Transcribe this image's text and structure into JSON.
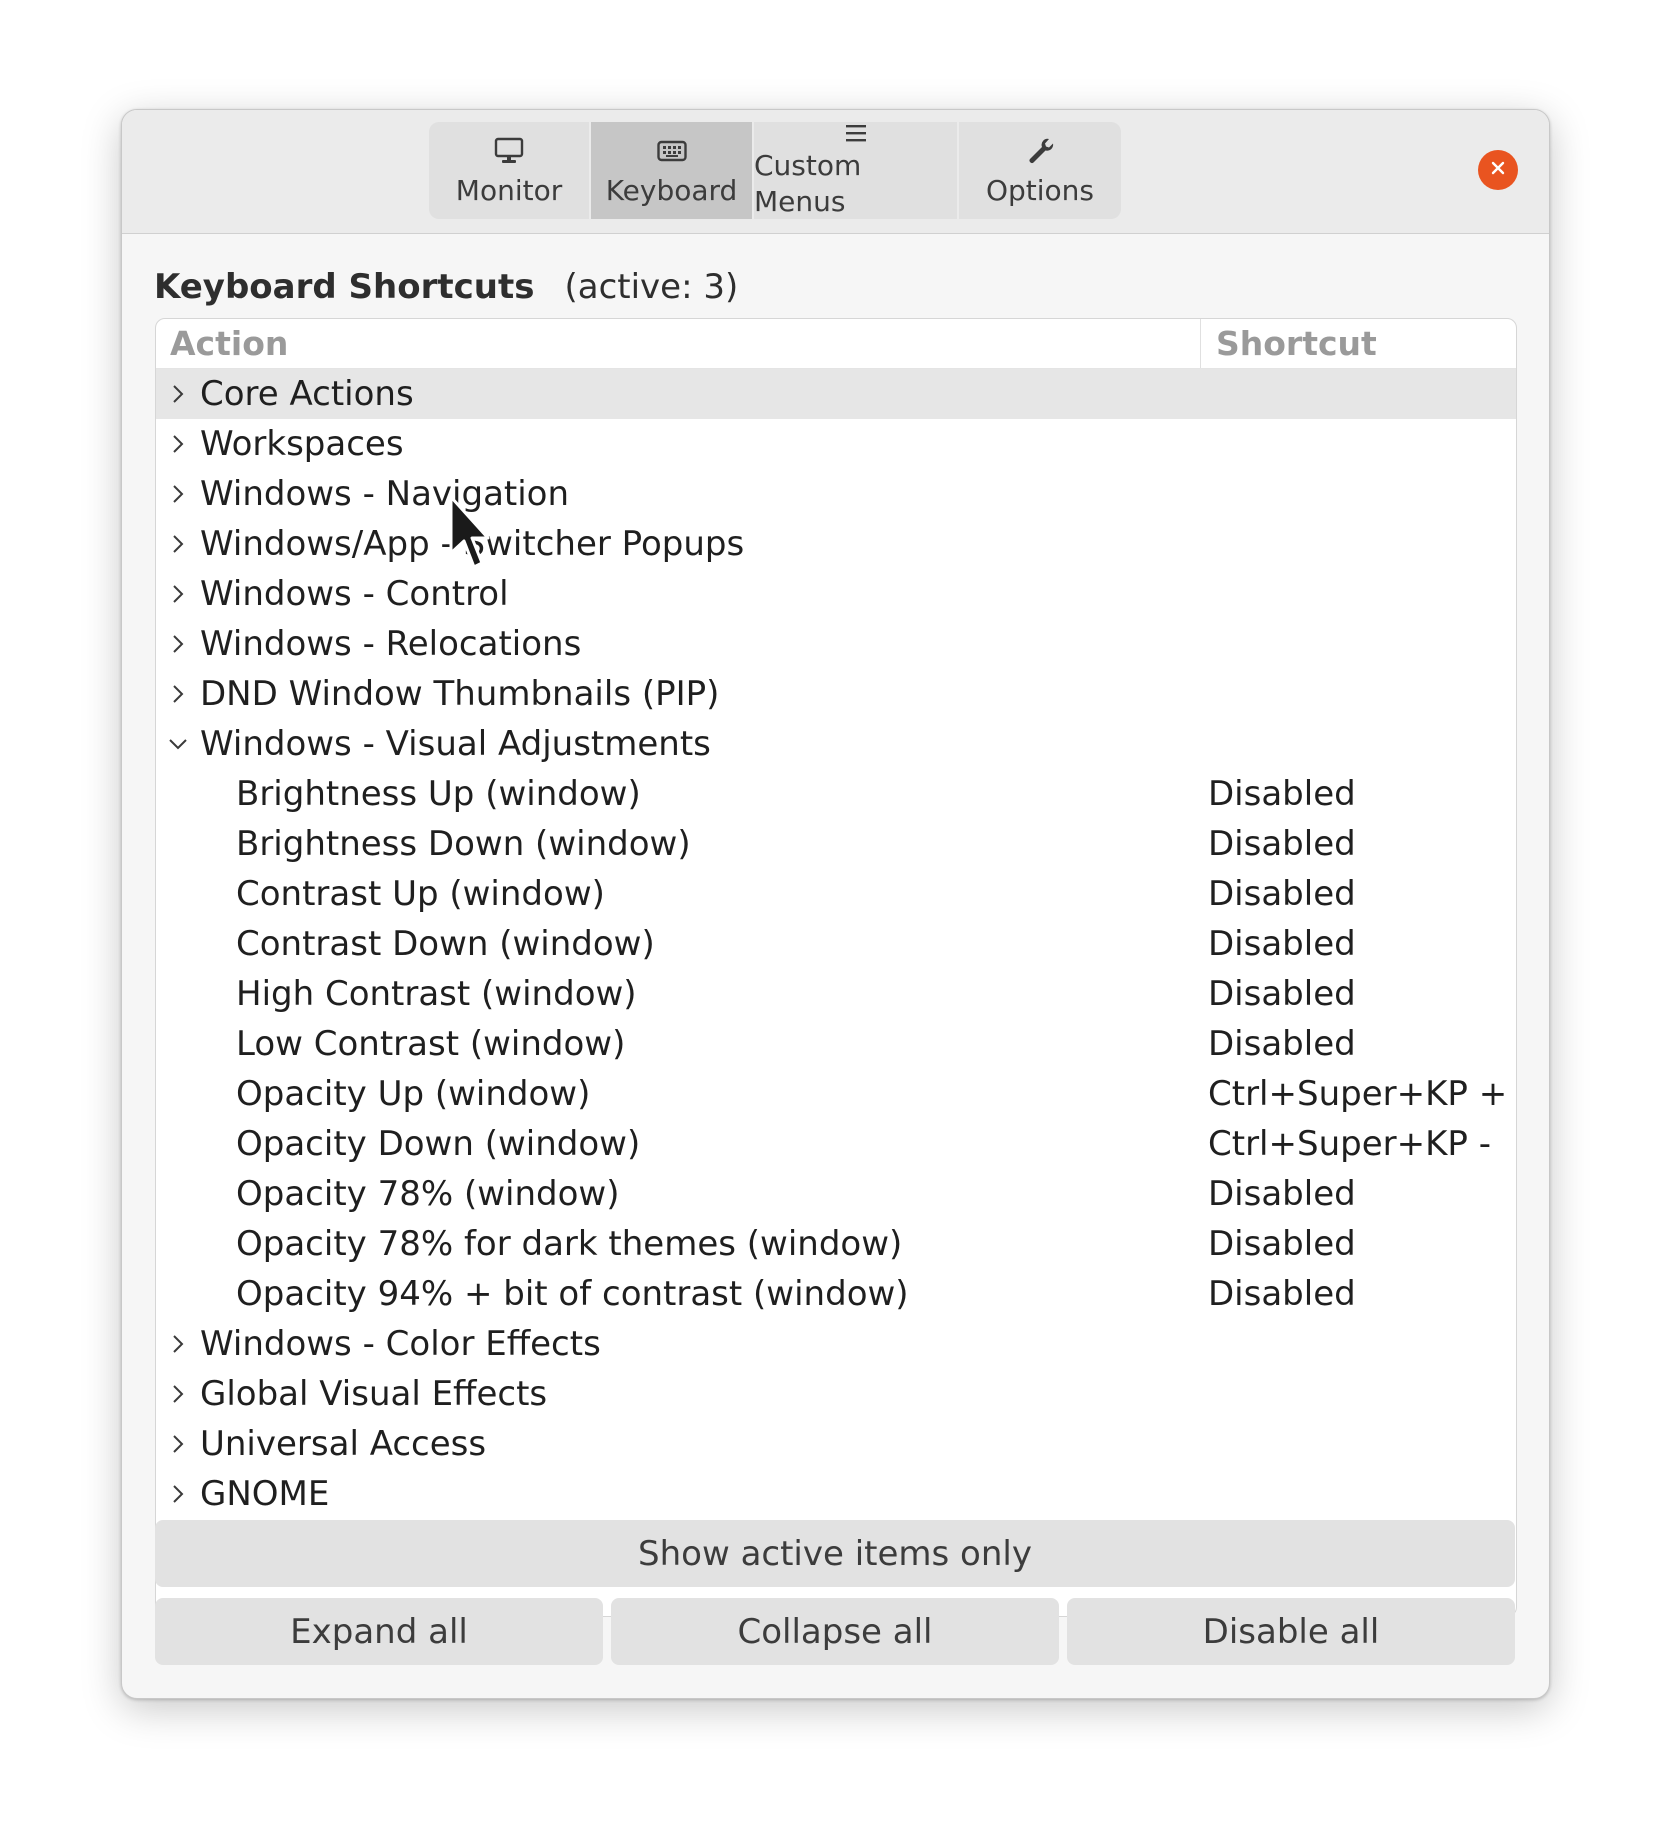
{
  "tabs": [
    {
      "label": "Monitor",
      "icon": "monitor-icon",
      "active": false
    },
    {
      "label": "Keyboard",
      "icon": "keyboard-icon",
      "active": true
    },
    {
      "label": "Custom Menus",
      "icon": "menu-icon",
      "active": false
    },
    {
      "label": "Options",
      "icon": "wrench-icon",
      "active": false
    }
  ],
  "close_icon": "close-icon",
  "accent_color": "#e95420",
  "section": {
    "title": "Keyboard Shortcuts",
    "count": "(active: 3)"
  },
  "tree": {
    "columns": {
      "action": "Action",
      "shortcut": "Shortcut"
    },
    "rows": [
      {
        "label": "Core Actions",
        "expanded": false,
        "selected": true
      },
      {
        "label": "Workspaces",
        "expanded": false
      },
      {
        "label": "Windows - Navigation",
        "expanded": false
      },
      {
        "label": "Windows/App - Switcher Popups",
        "expanded": false
      },
      {
        "label": "Windows - Control",
        "expanded": false
      },
      {
        "label": "Windows - Relocations",
        "expanded": false
      },
      {
        "label": "DND Window Thumbnails (PIP)",
        "expanded": false
      },
      {
        "label": "Windows - Visual Adjustments",
        "expanded": true
      },
      {
        "label": "Brightness Up (window)",
        "shortcut": "Disabled",
        "child": true
      },
      {
        "label": "Brightness Down (window)",
        "shortcut": "Disabled",
        "child": true
      },
      {
        "label": "Contrast Up (window)",
        "shortcut": "Disabled",
        "child": true
      },
      {
        "label": "Contrast Down (window)",
        "shortcut": "Disabled",
        "child": true
      },
      {
        "label": "High Contrast (window)",
        "shortcut": "Disabled",
        "child": true
      },
      {
        "label": "Low Contrast (window)",
        "shortcut": "Disabled",
        "child": true
      },
      {
        "label": "Opacity Up (window)",
        "shortcut": "Ctrl+Super+KP +",
        "child": true
      },
      {
        "label": "Opacity Down (window)",
        "shortcut": "Ctrl+Super+KP -",
        "child": true
      },
      {
        "label": "Opacity 78% (window)",
        "shortcut": "Disabled",
        "child": true
      },
      {
        "label": "Opacity 78% for dark themes (window)",
        "shortcut": "Disabled",
        "child": true
      },
      {
        "label": "Opacity 94% + bit of contrast (window)",
        "shortcut": "Disabled",
        "child": true
      },
      {
        "label": "Windows - Color Effects",
        "expanded": false
      },
      {
        "label": "Global Visual Effects",
        "expanded": false
      },
      {
        "label": "Universal Access",
        "expanded": false
      },
      {
        "label": "GNOME",
        "expanded": false
      }
    ]
  },
  "buttons": {
    "show_active": "Show active items only",
    "expand_all": "Expand all",
    "collapse_all": "Collapse all",
    "disable_all": "Disable all"
  }
}
